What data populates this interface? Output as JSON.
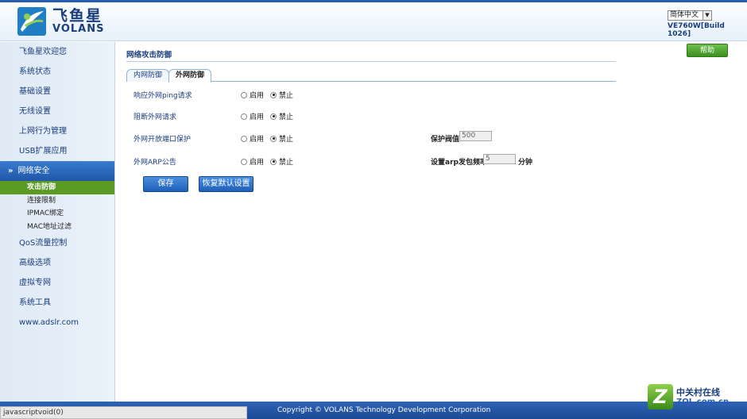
{
  "header": {
    "logo_cn": "飞鱼星",
    "logo_en": "VOLANS",
    "language": "简体中文",
    "build": "VE760W[Build 1026]"
  },
  "sidebar": {
    "items": [
      {
        "label": "飞鱼星欢迎您"
      },
      {
        "label": "系统状态"
      },
      {
        "label": "基础设置"
      },
      {
        "label": "无线设置"
      },
      {
        "label": "上网行为管理"
      },
      {
        "label": "USB扩展应用"
      },
      {
        "label": "网络安全",
        "active": true
      },
      {
        "label": "QoS流量控制"
      },
      {
        "label": "高级选项"
      },
      {
        "label": "虚拟专网"
      },
      {
        "label": "系统工具"
      },
      {
        "label": "www.adslr.com"
      }
    ],
    "subitems": [
      {
        "label": "攻击防御",
        "active": true
      },
      {
        "label": "连接限制"
      },
      {
        "label": "IPMAC绑定"
      },
      {
        "label": "MAC地址过滤"
      }
    ]
  },
  "main": {
    "title": "网络攻击防御",
    "help": "帮助",
    "tabs": [
      {
        "label": "内网防御"
      },
      {
        "label": "外网防御",
        "active": true
      }
    ],
    "rows": [
      {
        "label": "响应外网ping请求",
        "enable": "启用",
        "disable": "禁止",
        "selected": "disable"
      },
      {
        "label": "阻断外网请求",
        "enable": "启用",
        "disable": "禁止",
        "selected": "disable"
      },
      {
        "label": "外网开放端口保护",
        "enable": "启用",
        "disable": "禁止",
        "selected": "disable",
        "extra_label": "保护阀值",
        "extra_value": "500"
      },
      {
        "label": "外网ARP公告",
        "enable": "启用",
        "disable": "禁止",
        "selected": "disable",
        "extra_label": "设置arp发包频率",
        "extra_value": "5",
        "extra_unit": "分钟"
      }
    ],
    "save": "保存",
    "restore": "恢复默认设置"
  },
  "footer": {
    "copyright": "Copyright © VOLANS Technology Development Corporation",
    "status_url": "javascriptvoid(0)"
  },
  "watermark": {
    "cn": "中关村在线",
    "en": "ZOL.com.cn"
  },
  "colors": {
    "brand_blue": "#1a3d7c",
    "active_nav": "#2a66c0",
    "active_sub": "#5b9b24",
    "help_green": "#4fa52f"
  }
}
